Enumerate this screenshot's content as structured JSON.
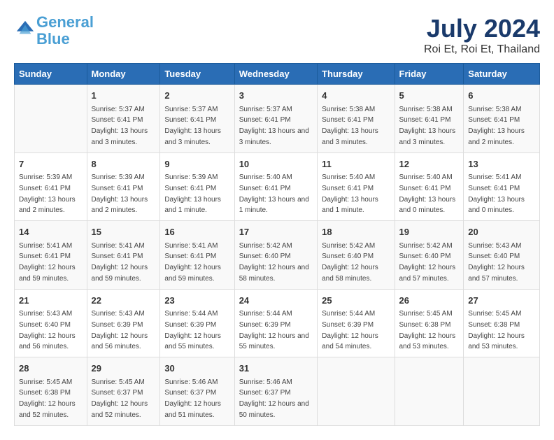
{
  "header": {
    "logo_line1": "General",
    "logo_line2": "Blue",
    "main_title": "July 2024",
    "subtitle": "Roi Et, Roi Et, Thailand"
  },
  "days": [
    "Sunday",
    "Monday",
    "Tuesday",
    "Wednesday",
    "Thursday",
    "Friday",
    "Saturday"
  ],
  "weeks": [
    [
      {
        "date": "",
        "sunrise": "",
        "sunset": "",
        "daylight": ""
      },
      {
        "date": "1",
        "sunrise": "Sunrise: 5:37 AM",
        "sunset": "Sunset: 6:41 PM",
        "daylight": "Daylight: 13 hours and 3 minutes."
      },
      {
        "date": "2",
        "sunrise": "Sunrise: 5:37 AM",
        "sunset": "Sunset: 6:41 PM",
        "daylight": "Daylight: 13 hours and 3 minutes."
      },
      {
        "date": "3",
        "sunrise": "Sunrise: 5:37 AM",
        "sunset": "Sunset: 6:41 PM",
        "daylight": "Daylight: 13 hours and 3 minutes."
      },
      {
        "date": "4",
        "sunrise": "Sunrise: 5:38 AM",
        "sunset": "Sunset: 6:41 PM",
        "daylight": "Daylight: 13 hours and 3 minutes."
      },
      {
        "date": "5",
        "sunrise": "Sunrise: 5:38 AM",
        "sunset": "Sunset: 6:41 PM",
        "daylight": "Daylight: 13 hours and 3 minutes."
      },
      {
        "date": "6",
        "sunrise": "Sunrise: 5:38 AM",
        "sunset": "Sunset: 6:41 PM",
        "daylight": "Daylight: 13 hours and 2 minutes."
      }
    ],
    [
      {
        "date": "7",
        "sunrise": "Sunrise: 5:39 AM",
        "sunset": "Sunset: 6:41 PM",
        "daylight": "Daylight: 13 hours and 2 minutes."
      },
      {
        "date": "8",
        "sunrise": "Sunrise: 5:39 AM",
        "sunset": "Sunset: 6:41 PM",
        "daylight": "Daylight: 13 hours and 2 minutes."
      },
      {
        "date": "9",
        "sunrise": "Sunrise: 5:39 AM",
        "sunset": "Sunset: 6:41 PM",
        "daylight": "Daylight: 13 hours and 1 minute."
      },
      {
        "date": "10",
        "sunrise": "Sunrise: 5:40 AM",
        "sunset": "Sunset: 6:41 PM",
        "daylight": "Daylight: 13 hours and 1 minute."
      },
      {
        "date": "11",
        "sunrise": "Sunrise: 5:40 AM",
        "sunset": "Sunset: 6:41 PM",
        "daylight": "Daylight: 13 hours and 1 minute."
      },
      {
        "date": "12",
        "sunrise": "Sunrise: 5:40 AM",
        "sunset": "Sunset: 6:41 PM",
        "daylight": "Daylight: 13 hours and 0 minutes."
      },
      {
        "date": "13",
        "sunrise": "Sunrise: 5:41 AM",
        "sunset": "Sunset: 6:41 PM",
        "daylight": "Daylight: 13 hours and 0 minutes."
      }
    ],
    [
      {
        "date": "14",
        "sunrise": "Sunrise: 5:41 AM",
        "sunset": "Sunset: 6:41 PM",
        "daylight": "Daylight: 12 hours and 59 minutes."
      },
      {
        "date": "15",
        "sunrise": "Sunrise: 5:41 AM",
        "sunset": "Sunset: 6:41 PM",
        "daylight": "Daylight: 12 hours and 59 minutes."
      },
      {
        "date": "16",
        "sunrise": "Sunrise: 5:41 AM",
        "sunset": "Sunset: 6:41 PM",
        "daylight": "Daylight: 12 hours and 59 minutes."
      },
      {
        "date": "17",
        "sunrise": "Sunrise: 5:42 AM",
        "sunset": "Sunset: 6:40 PM",
        "daylight": "Daylight: 12 hours and 58 minutes."
      },
      {
        "date": "18",
        "sunrise": "Sunrise: 5:42 AM",
        "sunset": "Sunset: 6:40 PM",
        "daylight": "Daylight: 12 hours and 58 minutes."
      },
      {
        "date": "19",
        "sunrise": "Sunrise: 5:42 AM",
        "sunset": "Sunset: 6:40 PM",
        "daylight": "Daylight: 12 hours and 57 minutes."
      },
      {
        "date": "20",
        "sunrise": "Sunrise: 5:43 AM",
        "sunset": "Sunset: 6:40 PM",
        "daylight": "Daylight: 12 hours and 57 minutes."
      }
    ],
    [
      {
        "date": "21",
        "sunrise": "Sunrise: 5:43 AM",
        "sunset": "Sunset: 6:40 PM",
        "daylight": "Daylight: 12 hours and 56 minutes."
      },
      {
        "date": "22",
        "sunrise": "Sunrise: 5:43 AM",
        "sunset": "Sunset: 6:39 PM",
        "daylight": "Daylight: 12 hours and 56 minutes."
      },
      {
        "date": "23",
        "sunrise": "Sunrise: 5:44 AM",
        "sunset": "Sunset: 6:39 PM",
        "daylight": "Daylight: 12 hours and 55 minutes."
      },
      {
        "date": "24",
        "sunrise": "Sunrise: 5:44 AM",
        "sunset": "Sunset: 6:39 PM",
        "daylight": "Daylight: 12 hours and 55 minutes."
      },
      {
        "date": "25",
        "sunrise": "Sunrise: 5:44 AM",
        "sunset": "Sunset: 6:39 PM",
        "daylight": "Daylight: 12 hours and 54 minutes."
      },
      {
        "date": "26",
        "sunrise": "Sunrise: 5:45 AM",
        "sunset": "Sunset: 6:38 PM",
        "daylight": "Daylight: 12 hours and 53 minutes."
      },
      {
        "date": "27",
        "sunrise": "Sunrise: 5:45 AM",
        "sunset": "Sunset: 6:38 PM",
        "daylight": "Daylight: 12 hours and 53 minutes."
      }
    ],
    [
      {
        "date": "28",
        "sunrise": "Sunrise: 5:45 AM",
        "sunset": "Sunset: 6:38 PM",
        "daylight": "Daylight: 12 hours and 52 minutes."
      },
      {
        "date": "29",
        "sunrise": "Sunrise: 5:45 AM",
        "sunset": "Sunset: 6:37 PM",
        "daylight": "Daylight: 12 hours and 52 minutes."
      },
      {
        "date": "30",
        "sunrise": "Sunrise: 5:46 AM",
        "sunset": "Sunset: 6:37 PM",
        "daylight": "Daylight: 12 hours and 51 minutes."
      },
      {
        "date": "31",
        "sunrise": "Sunrise: 5:46 AM",
        "sunset": "Sunset: 6:37 PM",
        "daylight": "Daylight: 12 hours and 50 minutes."
      },
      {
        "date": "",
        "sunrise": "",
        "sunset": "",
        "daylight": ""
      },
      {
        "date": "",
        "sunrise": "",
        "sunset": "",
        "daylight": ""
      },
      {
        "date": "",
        "sunrise": "",
        "sunset": "",
        "daylight": ""
      }
    ]
  ]
}
